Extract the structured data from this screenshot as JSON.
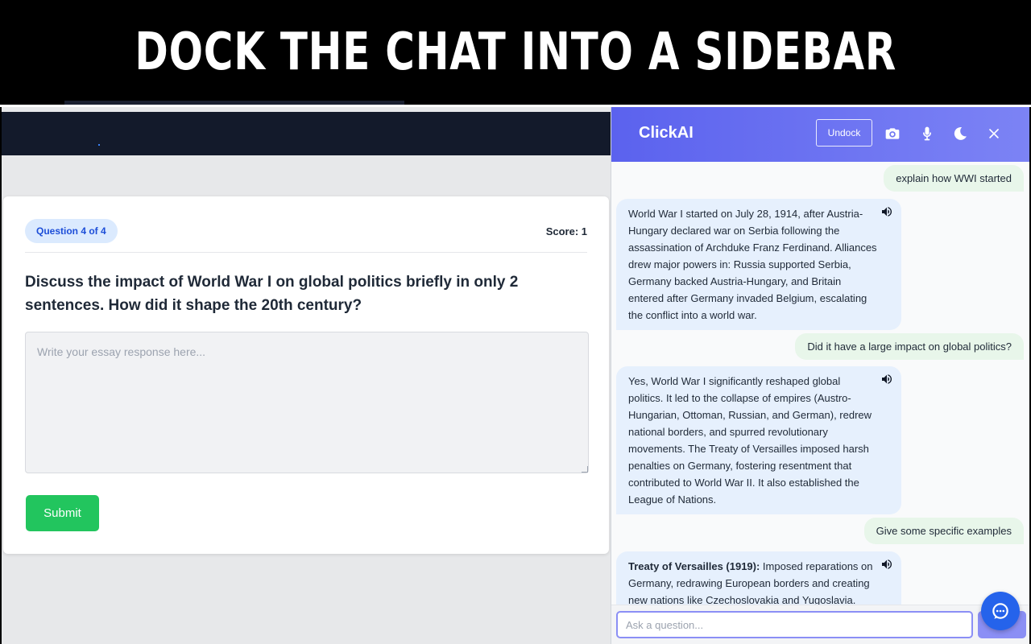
{
  "banner": {
    "title": "DOCK THE CHAT INTO A SIDEBAR"
  },
  "quiz": {
    "badge": "Question 4 of 4",
    "score": "Score: 1",
    "question": "Discuss the impact of World War I on global politics briefly in only 2 sentences. How did it shape the 20th century?",
    "essay_placeholder": "Write your essay response here...",
    "essay_value": "",
    "submit_label": "Submit"
  },
  "chat": {
    "title": "ClickAI",
    "undock_label": "Undock",
    "icons": [
      "camera-icon",
      "microphone-icon",
      "moon-icon",
      "close-icon"
    ],
    "messages": [
      {
        "role": "user",
        "text": "explain how WWI started"
      },
      {
        "role": "bot",
        "text": "World War I started on July 28, 1914, after Austria-Hungary declared war on Serbia following the assassination of Archduke Franz Ferdinand. Alliances drew major powers in: Russia supported Serbia, Germany backed Austria-Hungary, and Britain entered after Germany invaded Belgium, escalating the conflict into a world war."
      },
      {
        "role": "user",
        "text": "Did it have a large impact on global politics?"
      },
      {
        "role": "bot",
        "text": "Yes, World War I significantly reshaped global politics. It led to the collapse of empires (Austro-Hungarian, Ottoman, Russian, and German), redrew national borders, and spurred revolutionary movements. The Treaty of Versailles imposed harsh penalties on Germany, fostering resentment that contributed to World War II. It also established the League of Nations."
      },
      {
        "role": "user",
        "text": "Give some specific examples"
      },
      {
        "role": "bot",
        "bold": "Treaty of Versailles (1919):",
        "text": " Imposed reparations on Germany, redrawing European borders and creating new nations like Czechoslovakia and Yugoslavia."
      }
    ],
    "input_placeholder": "Ask a question...",
    "input_value": ""
  },
  "colors": {
    "header_start": "#5b62ee",
    "header_end": "#7c83f5",
    "submit": "#22c55e",
    "badge_bg": "#dbeafe",
    "user_bubble": "#e8f6ea",
    "bot_bubble": "#e6f0fd",
    "fab": "#2563eb"
  }
}
